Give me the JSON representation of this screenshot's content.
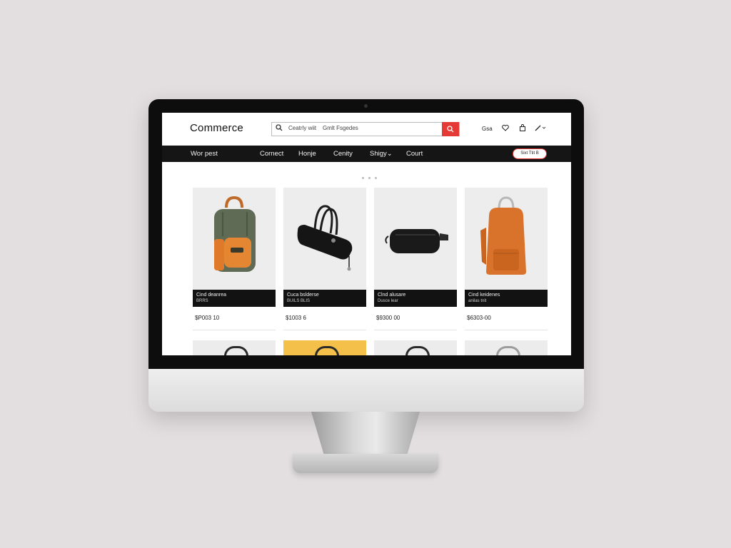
{
  "header": {
    "logo": "Commerce",
    "search_placeholder": "Ceatrly wiit    Gmlt Fsgedes",
    "search_icon": "search-icon",
    "search_button_icon": "search-icon",
    "link": "Gsa",
    "icons": [
      "heart-icon",
      "bag-icon",
      "edit-icon"
    ]
  },
  "nav": {
    "items": [
      "Wor pest",
      "Cornect",
      "Honje",
      "Cenity",
      "Shigy⌄",
      "Court"
    ],
    "button": "Sixt Ttit B"
  },
  "carousel_dots": 3,
  "products": [
    {
      "caption_line1": "Cind deanrea",
      "caption_line2": "BRRS",
      "price": "$P003 10",
      "image": "green-orange-backpack"
    },
    {
      "caption_line1": "Cuca bslderse",
      "caption_line2": "BUILS BLIS",
      "price": "$1003 6",
      "image": "black-handbag"
    },
    {
      "caption_line1": "Clnd alusare",
      "caption_line2": "Dusce lear",
      "price": "$9300 00",
      "image": "black-belt-bag"
    },
    {
      "caption_line1": "Cind keidenes",
      "caption_line2": "anilas tnit",
      "price": "$6303-00",
      "image": "orange-backpack"
    }
  ],
  "colors": {
    "accent": "#e53935",
    "nav_bg": "#151515",
    "caption_bg": "#121212",
    "background": "#e3dfe1"
  }
}
